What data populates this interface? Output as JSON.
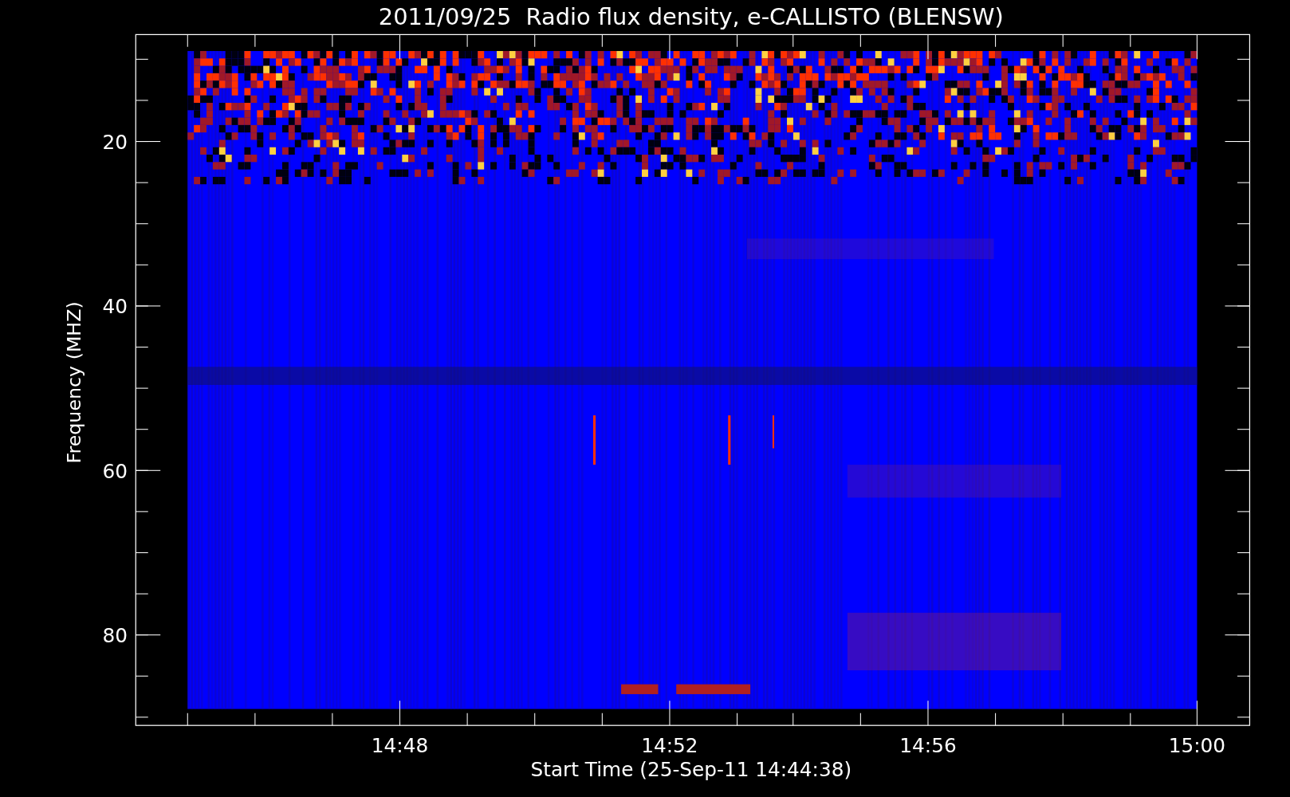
{
  "title": "2011/09/25  Radio flux density, e-CALLISTO (BLENSW)",
  "y_axis": {
    "label": "Frequency (MHZ)",
    "ticks": [
      "20",
      "40",
      "60",
      "80"
    ]
  },
  "x_axis": {
    "label": "Start Time (25-Sep-11 14:44:38)",
    "ticks": [
      "14:48",
      "14:52",
      "14:56",
      "15:00"
    ]
  }
}
